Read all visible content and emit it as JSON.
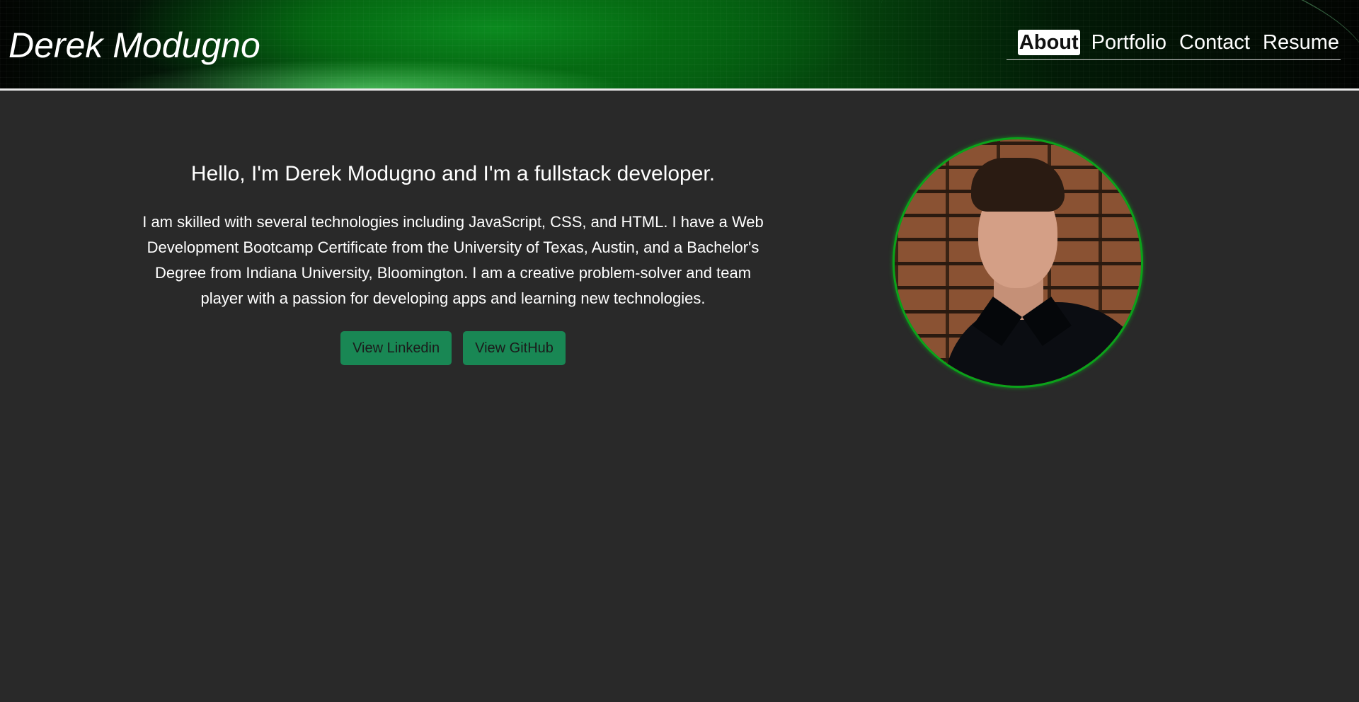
{
  "header": {
    "title": "Derek Modugno",
    "nav": [
      {
        "label": "About",
        "active": true
      },
      {
        "label": "Portfolio",
        "active": false
      },
      {
        "label": "Contact",
        "active": false
      },
      {
        "label": "Resume",
        "active": false
      }
    ]
  },
  "about": {
    "headline": "Hello, I'm Derek Modugno and I'm a fullstack developer.",
    "bio": "I am skilled with several technologies including JavaScript, CSS, and HTML. I have a Web Development Bootcamp Certificate from the University of Texas, Austin, and a Bachelor's Degree from Indiana University, Bloomington. I am a creative problem-solver and team player with a passion for developing apps and learning new technologies.",
    "buttons": {
      "linkedin": "View Linkedin",
      "github": "View GitHub"
    },
    "photo_alt": "Derek Modugno profile photo"
  },
  "colors": {
    "background": "#292929",
    "accent": "#198754",
    "header_green": "#066b15",
    "avatar_border": "#0aa31a"
  }
}
